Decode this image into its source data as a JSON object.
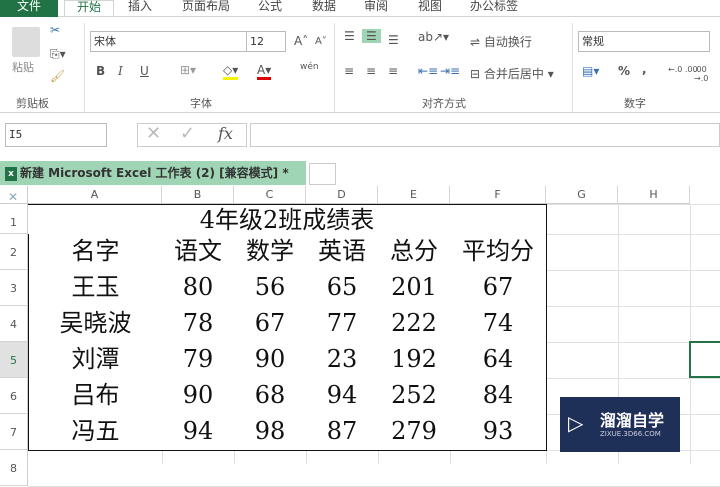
{
  "menu": {
    "file": "文件",
    "tabs": [
      "开始",
      "插入",
      "页面布局",
      "公式",
      "数据",
      "审阅",
      "视图",
      "办公标签"
    ]
  },
  "ribbon": {
    "clipboard": {
      "label": "剪贴板",
      "paste": "粘贴"
    },
    "font": {
      "label": "字体",
      "name": "宋体",
      "size": "12",
      "bold": "B",
      "italic": "I",
      "underline": "U",
      "phonetic": "wén"
    },
    "alignment": {
      "label": "对齐方式",
      "wrap": "自动换行",
      "merge": "合并后居中"
    },
    "number": {
      "label": "数字",
      "format": "常规",
      "percent": "%",
      "comma": ","
    }
  },
  "formula_bar": {
    "name_box": "I5",
    "fx": "fx",
    "value": ""
  },
  "workbook_tab": {
    "title": "新建 Microsoft Excel 工作表 (2)  [兼容模式] *"
  },
  "columns": [
    "A",
    "B",
    "C",
    "D",
    "E",
    "F",
    "G",
    "H"
  ],
  "rows": [
    "1",
    "2",
    "3",
    "4",
    "5",
    "6",
    "7",
    "8"
  ],
  "sheet": {
    "title": "4年级2班成绩表",
    "headers": [
      "名字",
      "语文",
      "数学",
      "英语",
      "总分",
      "平均分"
    ],
    "data": [
      [
        "王玉",
        "80",
        "56",
        "65",
        "201",
        "67"
      ],
      [
        "吴晓波",
        "78",
        "67",
        "77",
        "222",
        "74"
      ],
      [
        "刘潭",
        "79",
        "90",
        "23",
        "192",
        "64"
      ],
      [
        "吕布",
        "90",
        "68",
        "94",
        "252",
        "84"
      ],
      [
        "冯五",
        "94",
        "98",
        "87",
        "279",
        "93"
      ]
    ]
  },
  "watermark": {
    "name": "溜溜自学",
    "url": "ZIXUE.3D66.COM"
  },
  "colors": {
    "accent": "#217346",
    "tab_bg": "#9fd4b4",
    "watermark": "#1f3058"
  }
}
